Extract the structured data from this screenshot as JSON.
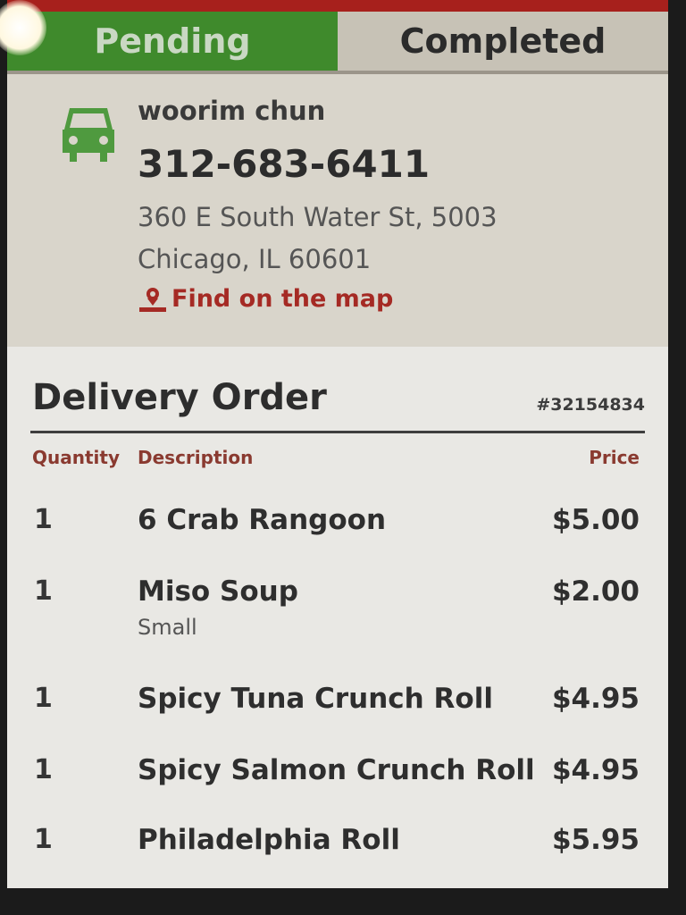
{
  "tabs": [
    {
      "label": "Pending",
      "active": true
    },
    {
      "label": "Completed",
      "active": false
    }
  ],
  "colors": {
    "accent_red": "#a7201c",
    "pending_green": "#3f8a2c",
    "link_red": "#a52a24",
    "car_icon": "#4f9a3f"
  },
  "customer": {
    "icon": "car-icon",
    "name": "woorim chun",
    "phone": "312-683-6411",
    "address_line1": "360 E South Water St,  5003",
    "address_line2": "Chicago,  IL 60601",
    "map_link": "Find on the map",
    "map_icon": "map-pin-icon"
  },
  "order": {
    "title": "Delivery Order",
    "number": "#32154834",
    "columns": {
      "quantity": "Quantity",
      "description": "Description",
      "price": "Price"
    },
    "items": [
      {
        "qty": "1",
        "description": "6 Crab Rangoon",
        "price": "$5.00",
        "option": ""
      },
      {
        "qty": "1",
        "description": "Miso Soup",
        "price": "$2.00",
        "option": "Small"
      },
      {
        "qty": "1",
        "description": "Spicy Tuna Crunch Roll",
        "price": "$4.95",
        "option": ""
      },
      {
        "qty": "1",
        "description": "Spicy Salmon Crunch Roll",
        "price": "$4.95",
        "option": ""
      },
      {
        "qty": "1",
        "description": "Philadelphia Roll",
        "price": "$5.95",
        "option": ""
      }
    ]
  }
}
